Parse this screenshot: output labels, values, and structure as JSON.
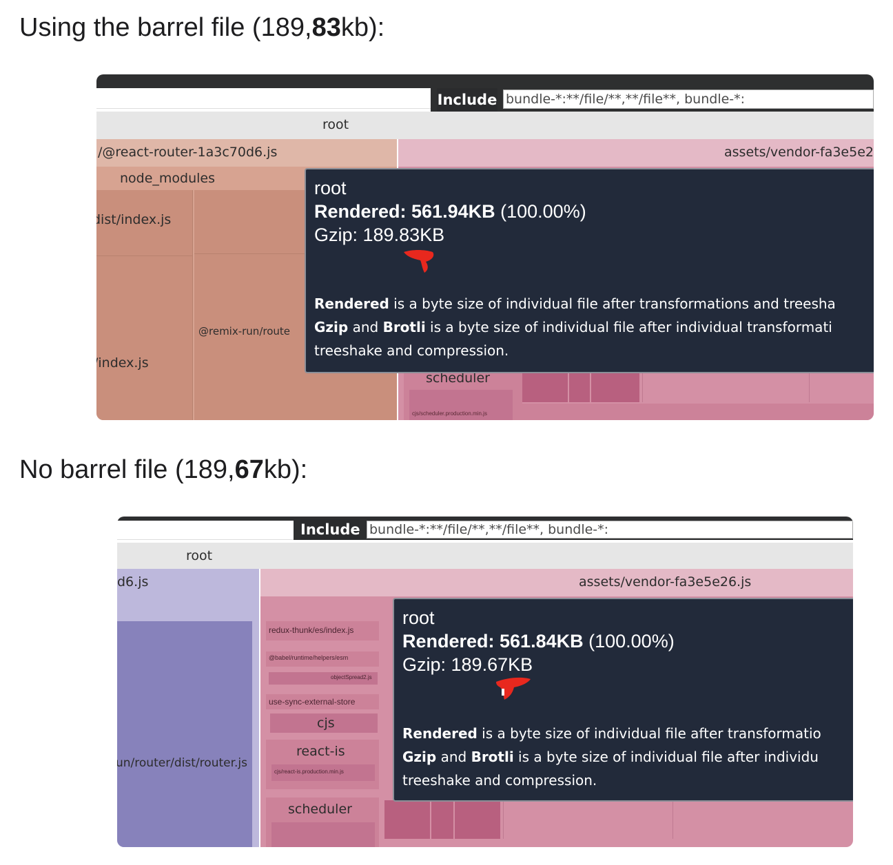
{
  "section1": {
    "heading_prefix": "Using the barrel file (189,",
    "heading_bold": "83",
    "heading_suffix": "kb):",
    "include_label": "Include",
    "include_value": "bundle-*:**/file/**,**/file**, bundle-*:",
    "root_label": "root",
    "left_bundle": "/@react-router-1a3c70d6.js",
    "right_bundle": "assets/vendor-fa3e5e2",
    "node_modules": "node_modules",
    "dist_index": "dist/index.js",
    "remix_router": "@remix-run/route",
    "index_js": "/index.js",
    "scheduler": "scheduler",
    "tiny_label": "cjs/scheduler.production.min.js",
    "tooltip": {
      "title": "root",
      "rendered_label": "Rendered: 561.94KB",
      "rendered_pct": "(100.00%)",
      "gzip": "Gzip: 189.83KB",
      "note1_bold": "Rendered",
      "note1_rest": " is a byte size of individual file after transformations and treesha",
      "note2_bold1": "Gzip",
      "note2_mid": " and ",
      "note2_bold2": "Brotli",
      "note2_rest": " is a byte size of individual file after individual transformati",
      "note3": "treeshake and compression."
    }
  },
  "section2": {
    "heading_prefix": "No barrel file (189,",
    "heading_bold": "67",
    "heading_suffix": "kb):",
    "include_label": "Include",
    "include_value": "bundle-*:**/file/**,**/file**, bundle-*:",
    "root_label": "root",
    "left_bundle": "d6.js",
    "right_bundle": "assets/vendor-fa3e5e26.js",
    "router_dist": "un/router/dist/router.js",
    "redux_thunk": "redux-thunk/es/index.js",
    "babel_runtime": "@babel/runtime/helpers/esm",
    "object_spread": "objectSpread2.js",
    "use_sync": "use-sync-external-store",
    "cjs": "cjs",
    "react_is": "react-is",
    "react_is_prod": "cjs/react-is.production.min.js",
    "scheduler": "scheduler",
    "tooltip": {
      "title": "root",
      "rendered_label": "Rendered: 561.84KB",
      "rendered_pct": "(100.00%)",
      "gzip": "Gzip: 189.67KB",
      "note1_bold": "Rendered",
      "note1_rest": " is a byte size of individual file after transformatio",
      "note2_bold1": "Gzip",
      "note2_mid": " and ",
      "note2_bold2": "Brotli",
      "note2_rest": " is a byte size of individual file after individu",
      "note3": "treeshake and compression."
    }
  },
  "colors": {
    "tan": "#c98f7c",
    "tan_light": "#dfb7a8",
    "pink": "#c97e95",
    "pink_light": "#e4b9c6",
    "purple": "#8782bb",
    "purple_light": "#bdb8dc",
    "tooltip_bg": "#222a3a",
    "annotation": "#e8281e"
  }
}
